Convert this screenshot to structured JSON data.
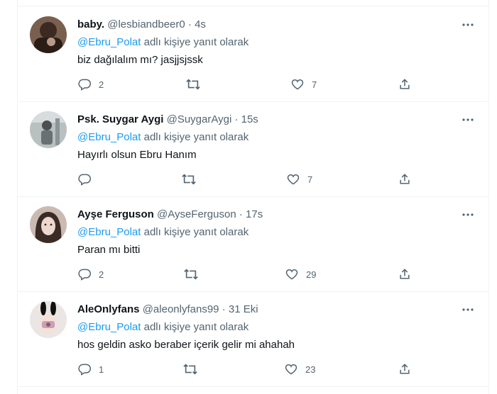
{
  "tweets": [
    {
      "name": "baby.",
      "handle": "@lesbiandbeer0",
      "dot": "·",
      "time": "4s",
      "mention": "@Ebru_Polat",
      "reply_suffix": "adlı kişiye yanıt olarak",
      "text": "biz dağılalım mı? jasjjsjssk",
      "replies": "2",
      "retweets": "",
      "likes": "7",
      "avatar_colors": [
        "#3b2a22",
        "#8a6a55"
      ]
    },
    {
      "name": "Psk. Suygar Aygi",
      "handle": "@SuygarAygi",
      "dot": "·",
      "time": "15s",
      "mention": "@Ebru_Polat",
      "reply_suffix": "adlı kişiye yanıt olarak",
      "text": "Hayırlı olsun Ebru Hanım",
      "replies": "",
      "retweets": "",
      "likes": "7",
      "avatar_colors": [
        "#9aa3a3",
        "#4b4f52"
      ]
    },
    {
      "name": "Ayşe Ferguson",
      "handle": "@AyseFerguson",
      "dot": "·",
      "time": "17s",
      "mention": "@Ebru_Polat",
      "reply_suffix": "adlı kişiye yanıt olarak",
      "text": "Paran mı bitti",
      "replies": "2",
      "retweets": "",
      "likes": "29",
      "avatar_colors": [
        "#d9c9c2",
        "#3a2b26"
      ]
    },
    {
      "name": "AleOnlyfans",
      "handle": "@aleonlyfans99",
      "dot": "·",
      "time": "31 Eki",
      "mention": "@Ebru_Polat",
      "reply_suffix": "adlı kişiye yanıt olarak",
      "text": "hos geldin asko beraber içerik gelir mi ahahah",
      "replies": "1",
      "retweets": "",
      "likes": "23",
      "avatar_colors": [
        "#e8e4e2",
        "#111111"
      ]
    }
  ],
  "icons": {
    "reply": "reply-icon",
    "retweet": "retweet-icon",
    "like": "heart-icon",
    "share": "share-icon",
    "more": "more-icon"
  },
  "colors": {
    "link": "#1d9bf0",
    "muted": "#536471",
    "text": "#0f1419",
    "divider": "#eff3f4"
  }
}
